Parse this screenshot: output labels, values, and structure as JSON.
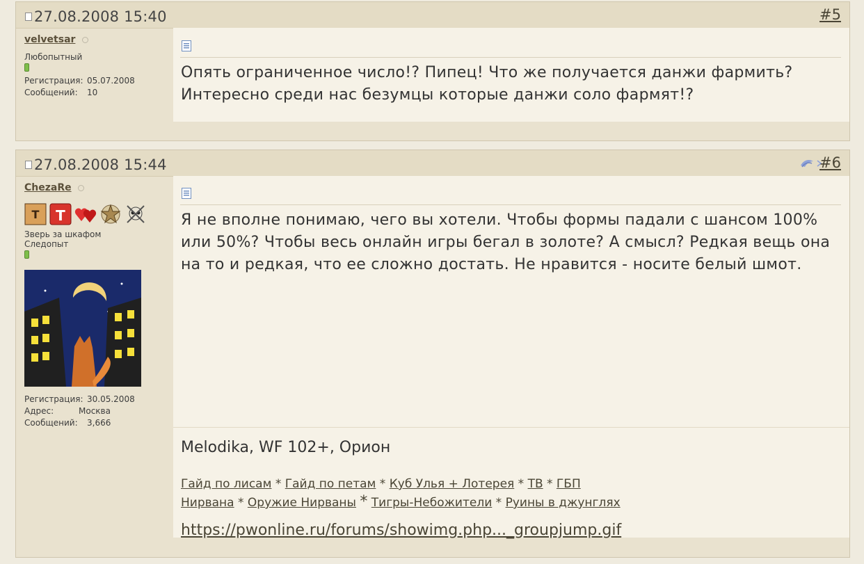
{
  "posts": [
    {
      "date": "27.08.2008 15:40",
      "number": "#5",
      "user": {
        "name": "velvetsar",
        "title": "Любопытный",
        "stats": [
          {
            "label": "Регистрация:",
            "value": "05.07.2008"
          },
          {
            "label": "Сообщений:",
            "value": "10"
          }
        ]
      },
      "message": "Опять ограниченное число!? Пипец! Что же получается данжи фармить? Интересно среди нас безумцы которые данжи соло фармят!?"
    },
    {
      "date": "27.08.2008 15:44",
      "number": "#6",
      "user": {
        "name": "ChezaRe",
        "badges": [
          "tester-badge-1",
          "tester-badge-2",
          "hearts-badge",
          "star-badge",
          "skull-badge"
        ],
        "title_line1": "Зверь за шкафом",
        "title_line2": "Следопыт",
        "stats": [
          {
            "label": "Регистрация:",
            "value": "30.05.2008"
          },
          {
            "label": "Адрес:",
            "value": "Москва"
          },
          {
            "label": "Сообщений:",
            "value": "3,666"
          }
        ]
      },
      "message": "Я не вполне понимаю, чего вы хотели. Чтобы формы падали с шансом 100% или 50%? Чтобы весь онлайн игры бегал в золоте? А смысл? Редкая вещь она на то и редкая, что ее сложно достать. Не нравится - носите белый шмот.",
      "signature": {
        "line1": "Melodika, WF 102+, Орион",
        "links_row1": [
          "Гайд по лисам",
          "Гайд по петам",
          "Куб Улья + Лотерея",
          "ТВ",
          "ГБП"
        ],
        "links_row2": [
          "Нирвана",
          "Оружие Нирваны",
          "Тигры-Небожители",
          "Руины в джунглях"
        ],
        "separator": "*",
        "url": "https://pwonline.ru/forums/showimg.php..._groupjump.gif"
      }
    }
  ],
  "colors": {
    "background": "#efebdf",
    "header": "#e4dcc5",
    "content": "#f6f2e7",
    "sidebar": "#e9e2cf"
  }
}
